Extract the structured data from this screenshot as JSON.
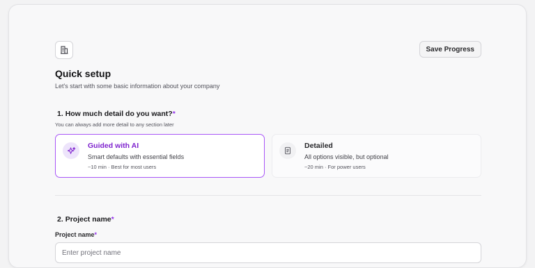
{
  "header": {
    "logo_icon": "building-icon",
    "save_label": "Save Progress",
    "title": "Quick setup",
    "subtitle": "Let's start with some basic information about your company"
  },
  "question1": {
    "number": "1.",
    "title": "How much detail do you want?",
    "required_mark": "*",
    "hint": "You can always add more detail to any section later",
    "options": [
      {
        "icon": "sparkles-icon",
        "title": "Guided with AI",
        "description": "Smart defaults with essential fields",
        "meta": "~10 min · Best for most users",
        "selected": true
      },
      {
        "icon": "document-icon",
        "title": "Detailed",
        "description": "All options visible, but optional",
        "meta": "~20 min · For power users",
        "selected": false
      }
    ]
  },
  "question2": {
    "number": "2.",
    "title": "Project name",
    "required_mark": "*",
    "field_label": "Project name",
    "field_value": "",
    "field_placeholder": "Enter project name"
  },
  "colors": {
    "accent": "#9333ea",
    "accent_border": "#a855f7",
    "accent_text": "#7e22ce"
  }
}
